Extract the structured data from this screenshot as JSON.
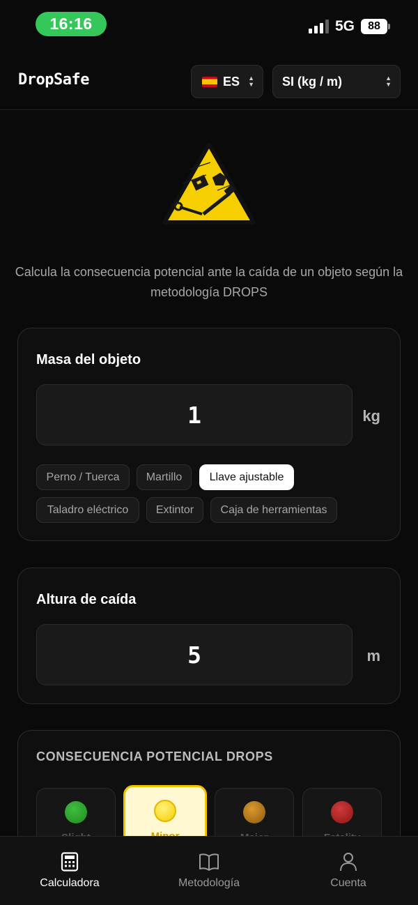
{
  "status_bar": {
    "time": "16:16",
    "network": "5G",
    "battery": "88"
  },
  "header": {
    "brand": "DropSafe",
    "language": {
      "flag": "spain-flag-icon",
      "value": "ES"
    },
    "units": {
      "value": "SI (kg / m)"
    }
  },
  "hero": {
    "icon": "falling-objects-warning-icon",
    "intro": "Calcula la consecuencia potencial ante la caída de un objeto según la metodología DROPS"
  },
  "mass": {
    "title": "Masa del objeto",
    "value": "1",
    "unit": "kg",
    "presets": [
      {
        "label": "Perno / Tuerca",
        "active": false
      },
      {
        "label": "Martillo",
        "active": false
      },
      {
        "label": "Llave ajustable",
        "active": true
      },
      {
        "label": "Taladro eléctrico",
        "active": false
      },
      {
        "label": "Extintor",
        "active": false
      },
      {
        "label": "Caja de herramientas",
        "active": false
      }
    ]
  },
  "height": {
    "title": "Altura de caída",
    "value": "5",
    "unit": "m"
  },
  "consequence": {
    "title": "CONSECUENCIA POTENCIAL DROPS",
    "levels": [
      {
        "label": "Slight",
        "color": "#1f8a1f",
        "active": false
      },
      {
        "label": "Minor",
        "color": "#f5cf00",
        "active": true
      },
      {
        "label": "Major",
        "color": "#b87400",
        "active": false
      },
      {
        "label": "Fatality",
        "color": "#a81c1c",
        "active": false
      }
    ]
  },
  "tabbar": {
    "items": [
      {
        "label": "Calculadora",
        "icon": "calculator-icon",
        "active": true
      },
      {
        "label": "Metodología",
        "icon": "book-icon",
        "active": false
      },
      {
        "label": "Cuenta",
        "icon": "user-icon",
        "active": false
      }
    ]
  },
  "colors": {
    "background": "#0a0a0a",
    "accent_yellow": "#f5cf00",
    "status_green": "#34c759"
  }
}
